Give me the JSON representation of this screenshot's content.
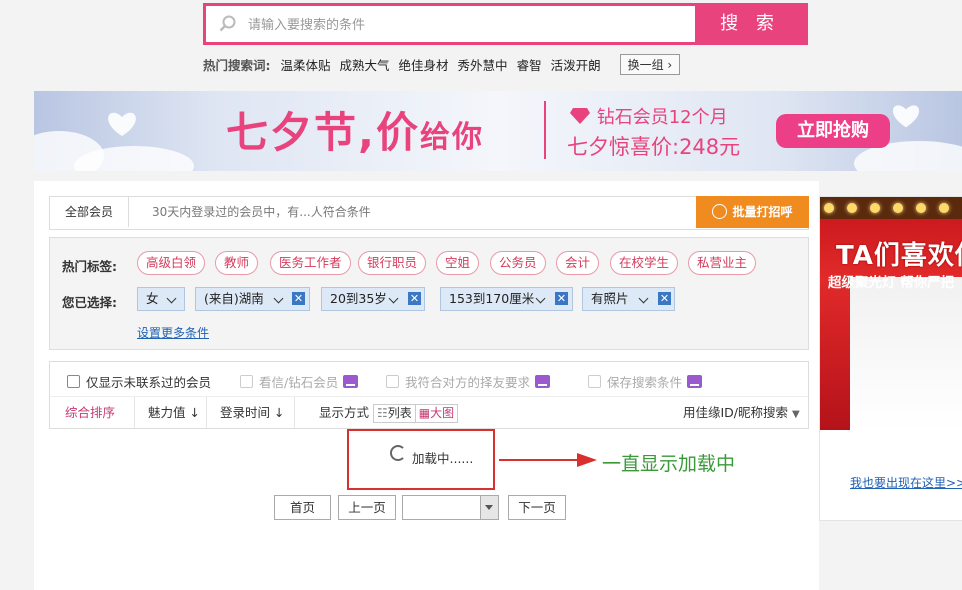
{
  "search": {
    "placeholder": "请输入要搜索的条件",
    "button": "搜 索"
  },
  "hot_search": {
    "label": "热门搜索词:",
    "keywords": [
      "温柔体贴",
      "成熟大气",
      "绝佳身材",
      "秀外慧中",
      "睿智",
      "活泼开朗"
    ],
    "change": "换一组"
  },
  "banner": {
    "title_a": "七夕节,",
    "title_b": "价",
    "title_c": "给你",
    "sub1": "钻石会员12个月",
    "sub2": "七夕惊喜价:248元",
    "button": "立即抢购"
  },
  "crumb": {
    "all": "全部会员",
    "desc": "30天内登录过的会员中，有...人符合条件",
    "bulk": "批量打招呼"
  },
  "filters": {
    "hot_label": "热门标签:",
    "tags": [
      "高级白领",
      "教师",
      "医务工作者",
      "银行职员",
      "空姐",
      "公务员",
      "会计",
      "在校学生",
      "私营业主"
    ],
    "chosen_label": "您已选择:",
    "chosen": [
      "女",
      "(来自)湖南",
      "20到35岁",
      "153到170厘米",
      "有照片"
    ],
    "more": "设置更多条件"
  },
  "options": {
    "uncontacted": "仅显示未联系过的会员",
    "view_diamond": "看信/钻石会员",
    "match_me": "我符合对方的择友要求",
    "save_search": "保存搜索条件"
  },
  "sort": {
    "overall": "综合排序",
    "charm": "魅力值",
    "login": "登录时间",
    "display_label": "显示方式",
    "list": "列表",
    "grid": "大图",
    "id_search": "用佳缘ID/昵称搜索"
  },
  "loading": {
    "text": "加载中......",
    "note": "一直显示加载中"
  },
  "pager": {
    "first": "首页",
    "prev": "上一页",
    "next": "下一页"
  },
  "ad": {
    "title": "TA们喜欢你",
    "sub": "超级聚光灯 帮你严把",
    "link": "我也要出现在这里>>"
  },
  "colors": {
    "brand_pink": "#e8437d",
    "bulk_orange": "#f08b1f",
    "link_blue": "#2062b3",
    "annotation_red": "#d9302f",
    "annotation_green": "#3a9a3a"
  }
}
